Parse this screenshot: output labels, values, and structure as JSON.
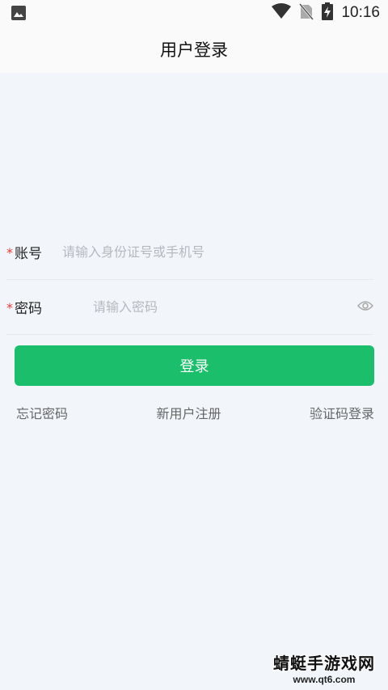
{
  "status_bar": {
    "time": "10:16",
    "icons": [
      "image-icon",
      "wifi-icon",
      "no-sim-icon",
      "battery-charging-icon"
    ]
  },
  "app_bar": {
    "title": "用户登录"
  },
  "form": {
    "account": {
      "required_mark": "*",
      "label": "账号",
      "placeholder": "请输入身份证号或手机号",
      "value": ""
    },
    "password": {
      "required_mark": "*",
      "label": "密码",
      "placeholder": "请输入密码",
      "value": "",
      "toggle_icon": "eye-icon"
    }
  },
  "login_button": {
    "label": "登录",
    "color": "#1bbe6a"
  },
  "links": {
    "forgot": "忘记密码",
    "register": "新用户注册",
    "code_login": "验证码登录"
  },
  "watermark": {
    "main": "蜻蜓手游戏网",
    "sub": "www.qt6.com"
  }
}
